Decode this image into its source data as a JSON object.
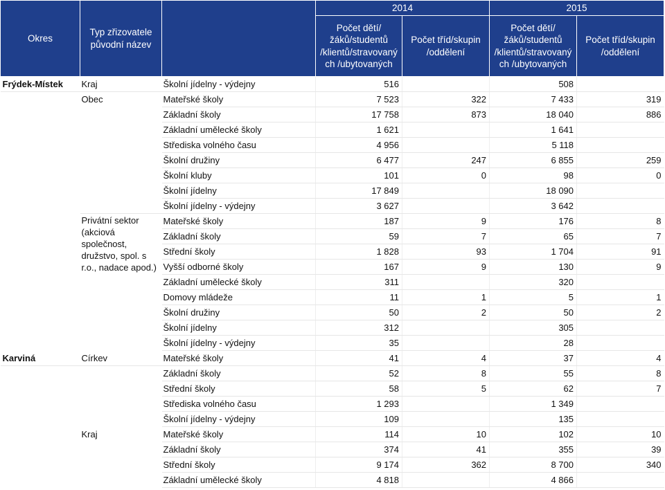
{
  "header": {
    "okres": "Okres",
    "typ": "Typ zřizovatele původní název",
    "year_2014": "2014",
    "year_2015": "2015",
    "pocet_deti": "Počet dětí/žáků/studentů /klientů/stravovaný ch /ubytovaných",
    "pocet_trid": "Počet tříd/skupin /oddělení"
  },
  "rows": [
    {
      "okres": "Frýdek-Místek",
      "zrizovatel": "Kraj",
      "typ": "Školní jídelny - výdejny",
      "d14": "516",
      "t14": "",
      "d15": "508",
      "t15": ""
    },
    {
      "okres": "",
      "zrizovatel": "Obec",
      "typ": "Mateřské školy",
      "d14": "7 523",
      "t14": "322",
      "d15": "7 433",
      "t15": "319"
    },
    {
      "okres": "",
      "zrizovatel": "",
      "typ": "Základní školy",
      "d14": "17 758",
      "t14": "873",
      "d15": "18 040",
      "t15": "886"
    },
    {
      "okres": "",
      "zrizovatel": "",
      "typ": "Základní umělecké školy",
      "d14": "1 621",
      "t14": "",
      "d15": "1 641",
      "t15": ""
    },
    {
      "okres": "",
      "zrizovatel": "",
      "typ": "Střediska volného času",
      "d14": "4 956",
      "t14": "",
      "d15": "5 118",
      "t15": ""
    },
    {
      "okres": "",
      "zrizovatel": "",
      "typ": "Školní družiny",
      "d14": "6 477",
      "t14": "247",
      "d15": "6 855",
      "t15": "259"
    },
    {
      "okres": "",
      "zrizovatel": "",
      "typ": "Školní kluby",
      "d14": "101",
      "t14": "0",
      "d15": "98",
      "t15": "0"
    },
    {
      "okres": "",
      "zrizovatel": "",
      "typ": "Školní jídelny",
      "d14": "17 849",
      "t14": "",
      "d15": "18 090",
      "t15": ""
    },
    {
      "okres": "",
      "zrizovatel": "",
      "typ": "Školní jídelny - výdejny",
      "d14": "3 627",
      "t14": "",
      "d15": "3 642",
      "t15": ""
    },
    {
      "okres": "",
      "zrizovatel": "Privátní sektor (akciová společnost, družstvo, spol. s r.o., nadace apod.)",
      "typ": "Mateřské školy",
      "d14": "187",
      "t14": "9",
      "d15": "176",
      "t15": "8"
    },
    {
      "okres": "",
      "zrizovatel": "",
      "typ": "Základní školy",
      "d14": "59",
      "t14": "7",
      "d15": "65",
      "t15": "7"
    },
    {
      "okres": "",
      "zrizovatel": "",
      "typ": "Střední školy",
      "d14": "1 828",
      "t14": "93",
      "d15": "1 704",
      "t15": "91"
    },
    {
      "okres": "",
      "zrizovatel": "",
      "typ": "Vyšší odborné školy",
      "d14": "167",
      "t14": "9",
      "d15": "130",
      "t15": "9"
    },
    {
      "okres": "",
      "zrizovatel": "",
      "typ": "Základní umělecké školy",
      "d14": "311",
      "t14": "",
      "d15": "320",
      "t15": ""
    },
    {
      "okres": "",
      "zrizovatel": "",
      "typ": "Domovy mládeže",
      "d14": "11",
      "t14": "1",
      "d15": "5",
      "t15": "1"
    },
    {
      "okres": "",
      "zrizovatel": "",
      "typ": "Školní družiny",
      "d14": "50",
      "t14": "2",
      "d15": "50",
      "t15": "2"
    },
    {
      "okres": "",
      "zrizovatel": "",
      "typ": "Školní jídelny",
      "d14": "312",
      "t14": "",
      "d15": "305",
      "t15": ""
    },
    {
      "okres": "",
      "zrizovatel": "",
      "typ": "Školní jídelny - výdejny",
      "d14": "35",
      "t14": "",
      "d15": "28",
      "t15": ""
    },
    {
      "okres": "Karviná",
      "zrizovatel": "Církev",
      "typ": "Mateřské školy",
      "d14": "41",
      "t14": "4",
      "d15": "37",
      "t15": "4"
    },
    {
      "okres": "",
      "zrizovatel": "",
      "typ": "Základní školy",
      "d14": "52",
      "t14": "8",
      "d15": "55",
      "t15": "8"
    },
    {
      "okres": "",
      "zrizovatel": "",
      "typ": "Střední školy",
      "d14": "58",
      "t14": "5",
      "d15": "62",
      "t15": "7"
    },
    {
      "okres": "",
      "zrizovatel": "",
      "typ": "Střediska volného času",
      "d14": "1 293",
      "t14": "",
      "d15": "1 349",
      "t15": ""
    },
    {
      "okres": "",
      "zrizovatel": "",
      "typ": "Školní jídelny - výdejny",
      "d14": "109",
      "t14": "",
      "d15": "135",
      "t15": ""
    },
    {
      "okres": "",
      "zrizovatel": "Kraj",
      "typ": "Mateřské školy",
      "d14": "114",
      "t14": "10",
      "d15": "102",
      "t15": "10"
    },
    {
      "okres": "",
      "zrizovatel": "",
      "typ": "Základní školy",
      "d14": "374",
      "t14": "41",
      "d15": "355",
      "t15": "39"
    },
    {
      "okres": "",
      "zrizovatel": "",
      "typ": "Střední školy",
      "d14": "9 174",
      "t14": "362",
      "d15": "8 700",
      "t15": "340"
    },
    {
      "okres": "",
      "zrizovatel": "",
      "typ": "Základní umělecké školy",
      "d14": "4 818",
      "t14": "",
      "d15": "4 866",
      "t15": ""
    }
  ]
}
